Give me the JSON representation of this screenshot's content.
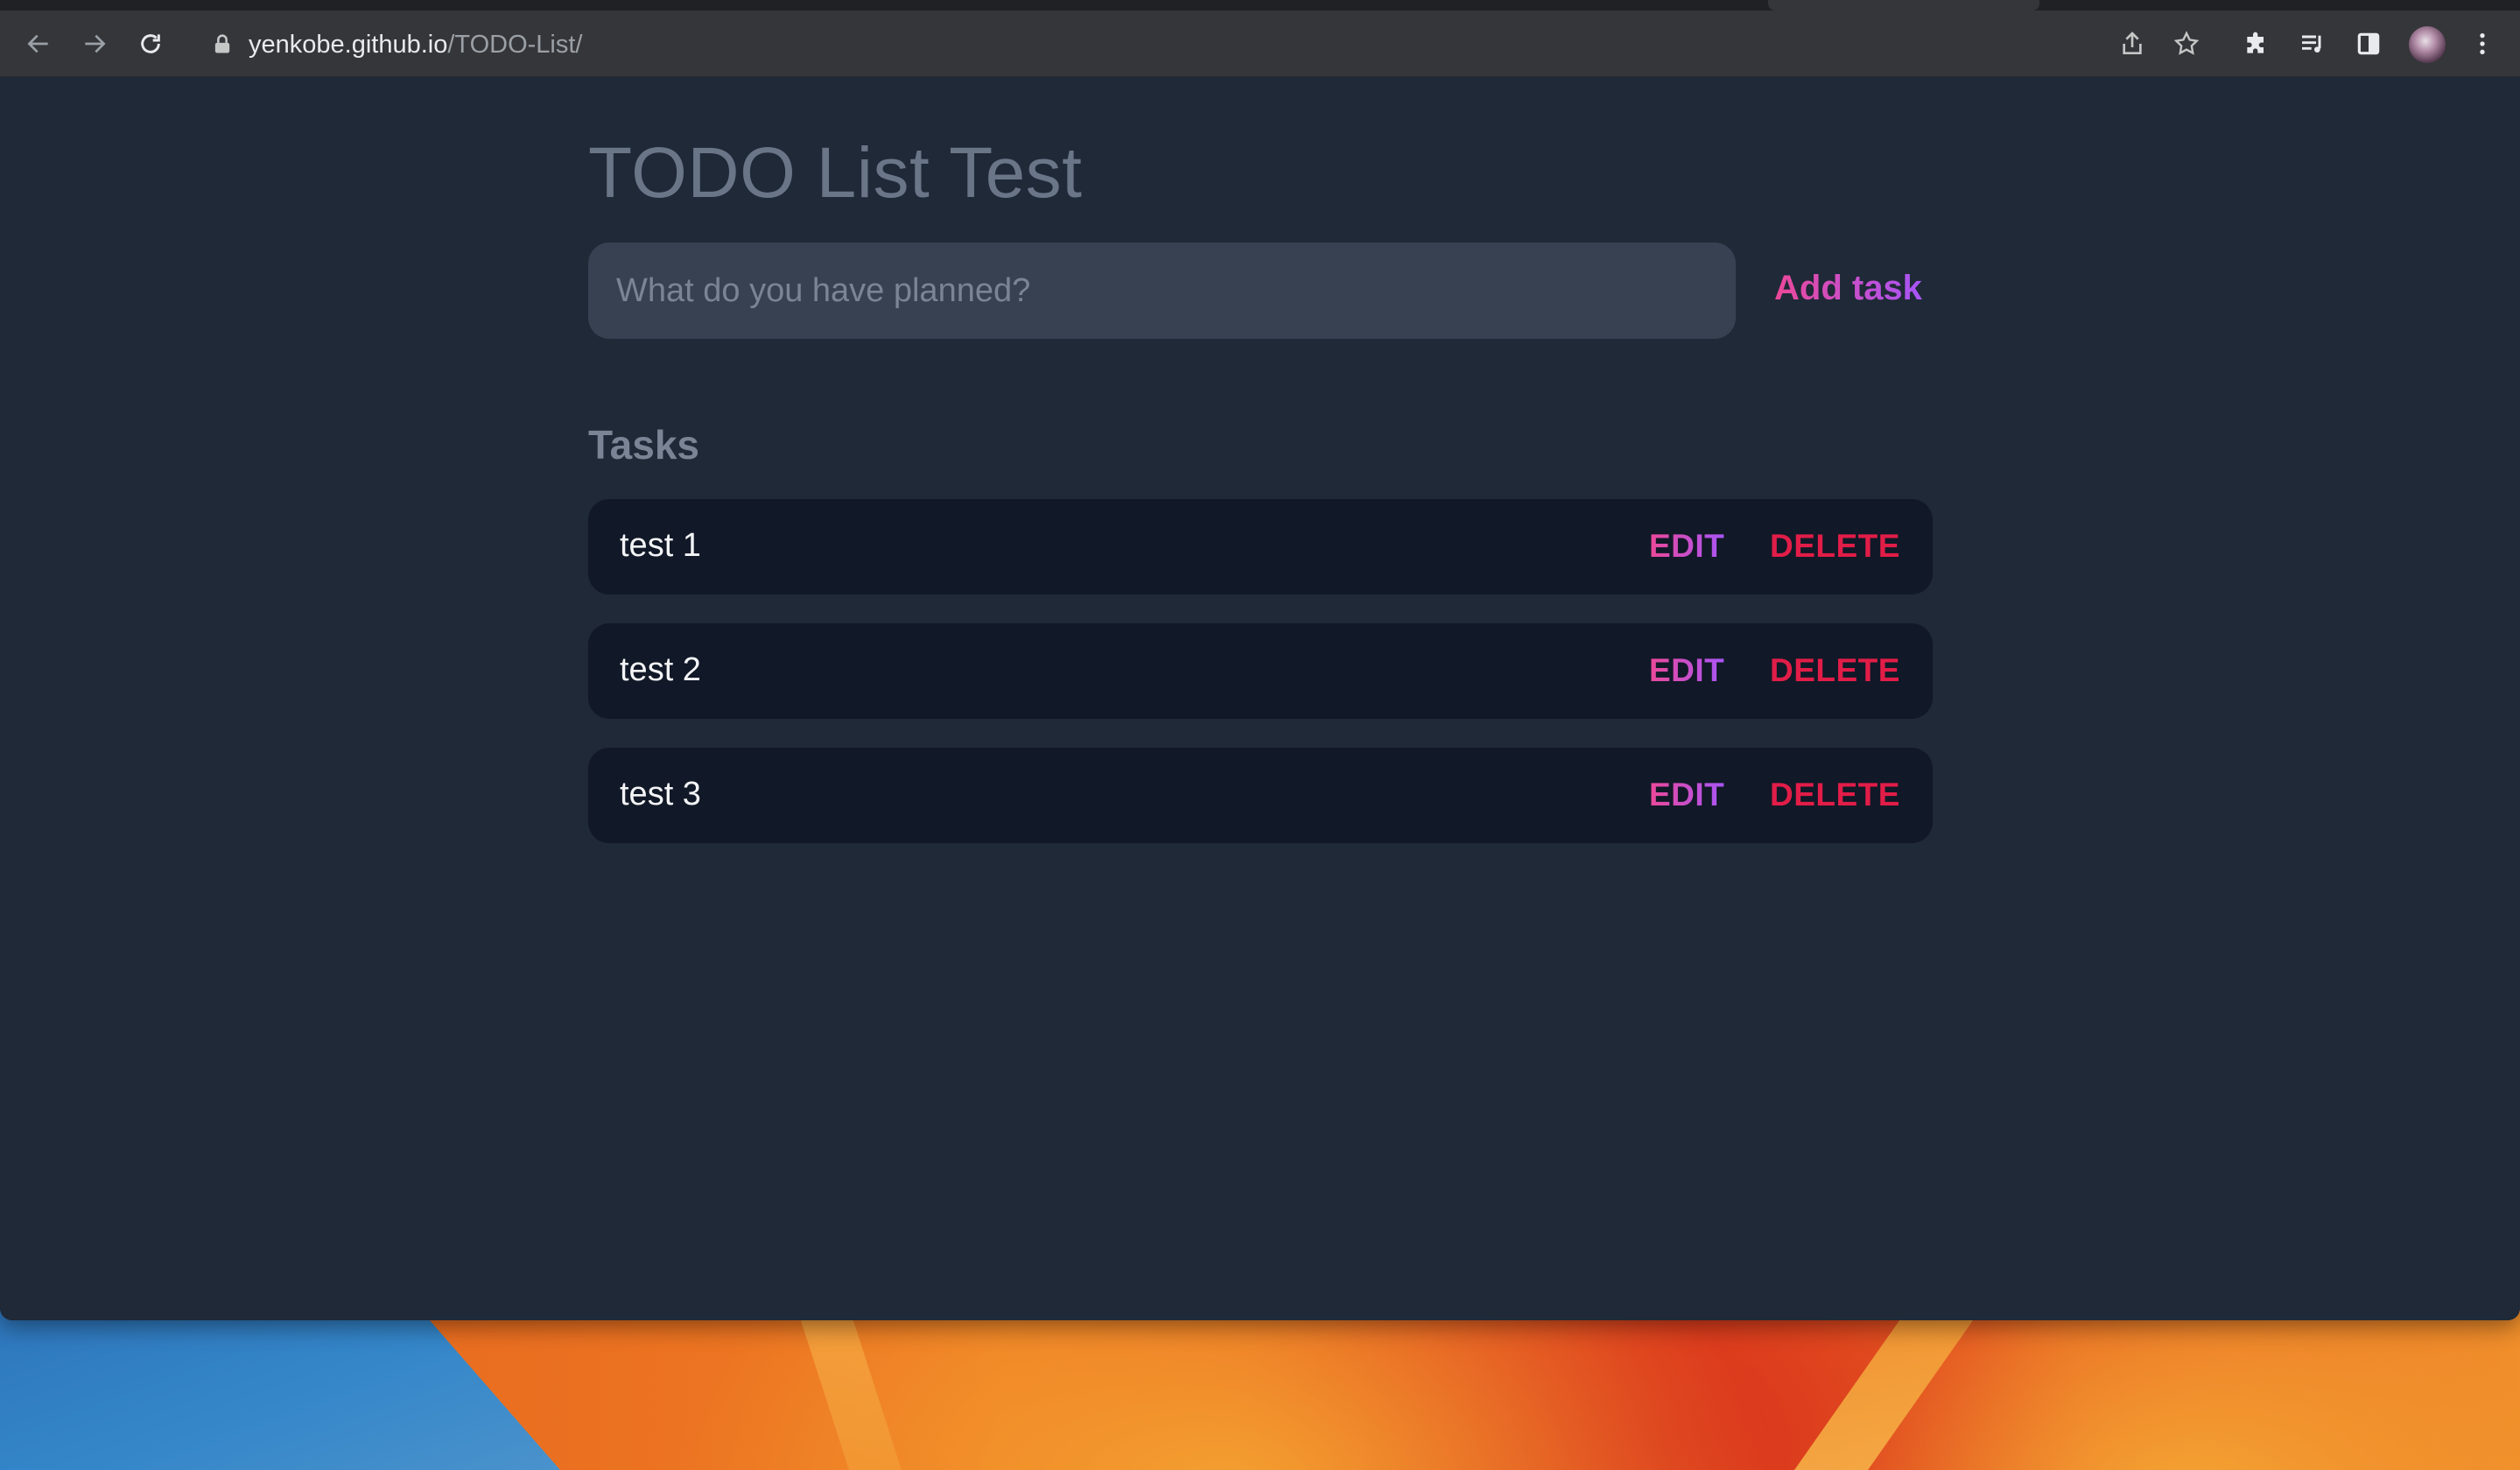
{
  "browser": {
    "url_domain": "yenkobe.github.io",
    "url_path": "/TODO-List/"
  },
  "app": {
    "title": "TODO List Test",
    "input_placeholder": "What do you have planned?",
    "input_value": "",
    "add_button_label": "Add task",
    "tasks_heading": "Tasks",
    "tasks": [
      {
        "text": "test 1",
        "edit_label": "EDIT",
        "delete_label": "DELETE"
      },
      {
        "text": "test 2",
        "edit_label": "EDIT",
        "delete_label": "DELETE"
      },
      {
        "text": "test 3",
        "edit_label": "EDIT",
        "delete_label": "DELETE"
      }
    ]
  },
  "colors": {
    "page_bg": "#1f2937",
    "task_bg": "#111827",
    "input_bg": "#374151",
    "accent_gradient_start": "#ec4899",
    "accent_gradient_end": "#a855f7",
    "delete_color": "#e11d48"
  },
  "icons": {
    "back": "arrow-left-icon",
    "forward": "arrow-right-icon",
    "reload": "reload-icon",
    "lock": "lock-icon",
    "share": "share-icon",
    "bookmark": "star-icon",
    "extensions": "puzzle-icon",
    "media": "media-queue-icon",
    "side_panel": "side-panel-icon",
    "menu": "kebab-menu-icon"
  }
}
